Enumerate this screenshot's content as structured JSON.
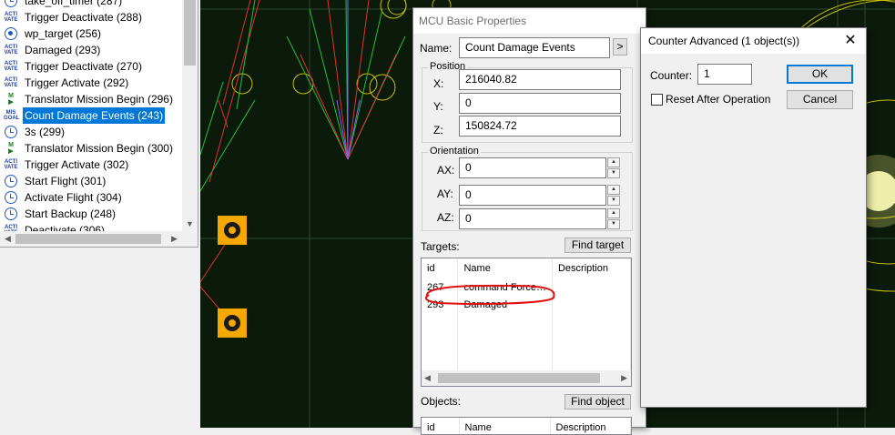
{
  "tree": {
    "items": [
      {
        "label": "take_off_timer (287)",
        "icon": "timer-icon"
      },
      {
        "label": "Trigger Deactivate (288)",
        "icon": "activate-icon"
      },
      {
        "label": "wp_target (256)",
        "icon": "target-icon"
      },
      {
        "label": "Damaged (293)",
        "icon": "activate-icon"
      },
      {
        "label": "Trigger Deactivate (270)",
        "icon": "activate-icon"
      },
      {
        "label": "Trigger Activate (292)",
        "icon": "activate-icon"
      },
      {
        "label": "Translator Mission Begin (296)",
        "icon": "mission-icon"
      },
      {
        "label": "Count Damage Events (243)",
        "icon": "goal-icon",
        "selected": true
      },
      {
        "label": "3s (299)",
        "icon": "timer-icon"
      },
      {
        "label": "Translator Mission Begin (300)",
        "icon": "mission-icon"
      },
      {
        "label": "Trigger Activate (302)",
        "icon": "activate-icon"
      },
      {
        "label": "Start Flight (301)",
        "icon": "timer-icon"
      },
      {
        "label": "Activate Flight (304)",
        "icon": "timer-icon"
      },
      {
        "label": "Start Backup (248)",
        "icon": "timer-icon"
      },
      {
        "label": "Deactivate (306)",
        "icon": "activate-icon"
      }
    ],
    "icon_text": {
      "activate": "ACTI\nVATE",
      "mission": "M",
      "goal": "MIS\nGOAL"
    }
  },
  "mcu": {
    "title": "MCU Basic Properties",
    "name_label": "Name:",
    "name_value": "Count Damage Events",
    "name_btn": ">",
    "position_caption": "Position",
    "x_label": "X:",
    "x_value": "216040.82",
    "y_label": "Y:",
    "y_value": "0",
    "z_label": "Z:",
    "z_value": "150824.72",
    "orientation_caption": "Orientation",
    "ax_label": "AX:",
    "ax_value": "0",
    "ay_label": "AY:",
    "ay_value": "0",
    "az_label": "AZ:",
    "az_value": "0",
    "targets_label": "Targets:",
    "find_target": "Find target",
    "targets_columns": {
      "id": "id",
      "name": "Name",
      "desc": "Description"
    },
    "targets_rows": [
      {
        "id": "267",
        "name": "command Force…",
        "desc": ""
      },
      {
        "id": "293",
        "name": "Damaged",
        "desc": ""
      }
    ],
    "objects_label": "Objects:",
    "find_object": "Find object",
    "objects_columns": {
      "id": "id",
      "name": "Name",
      "desc": "Description"
    }
  },
  "counter": {
    "title": "Counter Advanced (1 object(s))",
    "counter_label": "Counter:",
    "counter_value": "1",
    "reset_label": "Reset After Operation",
    "reset_checked": false,
    "ok": "OK",
    "cancel": "Cancel"
  },
  "colors": {
    "accent": "#0078d7",
    "annotation": "#e01010",
    "node": "#f5a800",
    "viewport": "#0c1a0c"
  }
}
